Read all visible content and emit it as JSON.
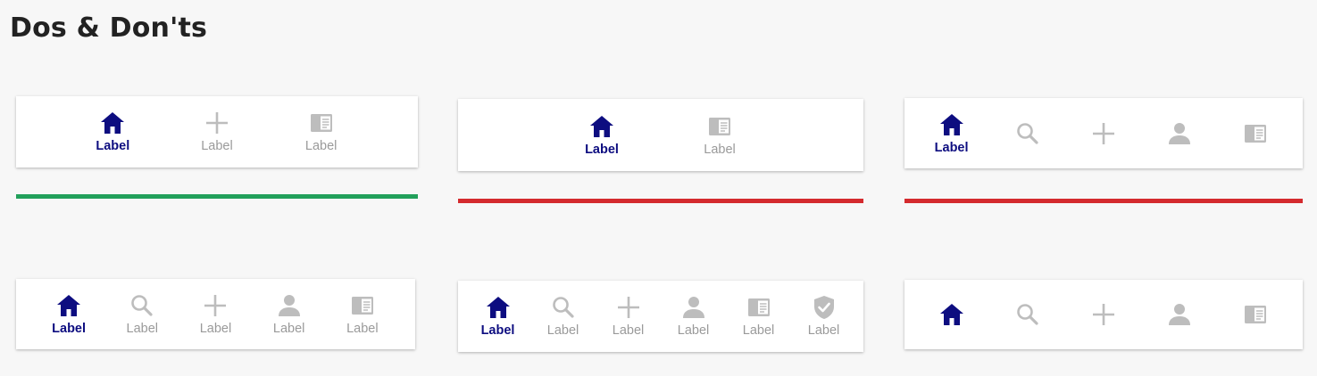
{
  "title": "Dos & Don'ts",
  "colors": {
    "active": "#0d0d80",
    "inactive": "#bdbdbd",
    "do": "#22a05b",
    "dont": "#d42a2e"
  },
  "examples": [
    {
      "id": "ex1",
      "status": "do",
      "tabs": [
        {
          "icon": "home-icon",
          "label": "Label",
          "active": true
        },
        {
          "icon": "plus-icon",
          "label": "Label",
          "active": false
        },
        {
          "icon": "reader-icon",
          "label": "Label",
          "active": false
        }
      ]
    },
    {
      "id": "ex2",
      "status": "dont",
      "tabs": [
        {
          "icon": "home-icon",
          "label": "Label",
          "active": true
        },
        {
          "icon": "reader-icon",
          "label": "Label",
          "active": false
        }
      ]
    },
    {
      "id": "ex3",
      "status": "dont",
      "tabs": [
        {
          "icon": "home-icon",
          "label": "Label",
          "active": true
        },
        {
          "icon": "search-icon",
          "label": "",
          "active": false
        },
        {
          "icon": "plus-icon",
          "label": "",
          "active": false
        },
        {
          "icon": "person-icon",
          "label": "",
          "active": false
        },
        {
          "icon": "reader-icon",
          "label": "",
          "active": false
        }
      ]
    },
    {
      "id": "ex4",
      "status": "",
      "tabs": [
        {
          "icon": "home-icon",
          "label": "Label",
          "active": true
        },
        {
          "icon": "search-icon",
          "label": "Label",
          "active": false
        },
        {
          "icon": "plus-icon",
          "label": "Label",
          "active": false
        },
        {
          "icon": "person-icon",
          "label": "Label",
          "active": false
        },
        {
          "icon": "reader-icon",
          "label": "Label",
          "active": false
        }
      ]
    },
    {
      "id": "ex5",
      "status": "",
      "tabs": [
        {
          "icon": "home-icon",
          "label": "Label",
          "active": true
        },
        {
          "icon": "search-icon",
          "label": "Label",
          "active": false
        },
        {
          "icon": "plus-icon",
          "label": "Label",
          "active": false
        },
        {
          "icon": "person-icon",
          "label": "Label",
          "active": false
        },
        {
          "icon": "reader-icon",
          "label": "Label",
          "active": false
        },
        {
          "icon": "shield-check-icon",
          "label": "Label",
          "active": false
        }
      ]
    },
    {
      "id": "ex6",
      "status": "",
      "tabs": [
        {
          "icon": "home-icon",
          "label": "",
          "active": true
        },
        {
          "icon": "search-icon",
          "label": "",
          "active": false
        },
        {
          "icon": "plus-icon",
          "label": "",
          "active": false
        },
        {
          "icon": "person-icon",
          "label": "",
          "active": false
        },
        {
          "icon": "reader-icon",
          "label": "",
          "active": false
        }
      ]
    }
  ]
}
